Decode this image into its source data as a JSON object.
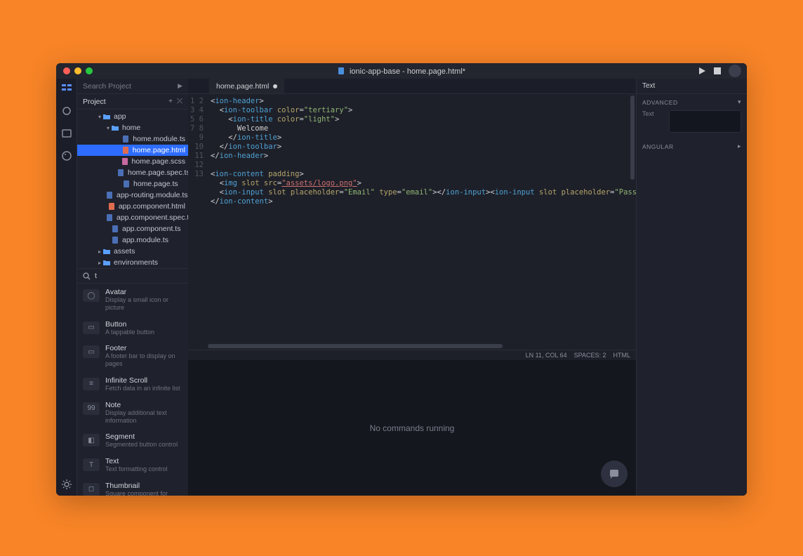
{
  "window": {
    "title_prefix": "ionic-app-base - ",
    "title_file": "home.page.html*"
  },
  "sidebar": {
    "search_placeholder": "Search Project",
    "project_label": "Project",
    "tree": [
      {
        "indent": 28,
        "icon": "folder",
        "label": "app",
        "arrow": "▾"
      },
      {
        "indent": 40,
        "icon": "folder",
        "label": "home",
        "arrow": "▾"
      },
      {
        "indent": 56,
        "icon": "ts",
        "label": "home.module.ts"
      },
      {
        "indent": 56,
        "icon": "html",
        "label": "home.page.html",
        "selected": true
      },
      {
        "indent": 56,
        "icon": "scss",
        "label": "home.page.scss"
      },
      {
        "indent": 56,
        "icon": "ts",
        "label": "home.page.spec.ts"
      },
      {
        "indent": 56,
        "icon": "ts",
        "label": "home.page.ts"
      },
      {
        "indent": 40,
        "icon": "ts",
        "label": "app-routing.module.ts"
      },
      {
        "indent": 40,
        "icon": "html",
        "label": "app.component.html"
      },
      {
        "indent": 40,
        "icon": "ts",
        "label": "app.component.spec.ts"
      },
      {
        "indent": 40,
        "icon": "ts",
        "label": "app.component.ts"
      },
      {
        "indent": 40,
        "icon": "ts",
        "label": "app.module.ts"
      },
      {
        "indent": 28,
        "icon": "folder",
        "label": "assets",
        "arrow": "▸"
      },
      {
        "indent": 28,
        "icon": "folder",
        "label": "environments",
        "arrow": "▸"
      }
    ],
    "filter_value": "t",
    "components": [
      {
        "name": "Avatar",
        "desc": "Display a small icon or picture",
        "glyph": "◯"
      },
      {
        "name": "Button",
        "desc": "A tappable button",
        "glyph": "▭"
      },
      {
        "name": "Footer",
        "desc": "A footer bar to display on pages",
        "glyph": "▭"
      },
      {
        "name": "Infinite Scroll",
        "desc": "Fetch data in an infinite list",
        "glyph": "≡"
      },
      {
        "name": "Note",
        "desc": "Display additional text information",
        "glyph": "99"
      },
      {
        "name": "Segment",
        "desc": "Segmented button control",
        "glyph": "◧"
      },
      {
        "name": "Text",
        "desc": "Text formatting control",
        "glyph": "T"
      },
      {
        "name": "Thumbnail",
        "desc": "Square component for displaying icons",
        "glyph": "◻"
      }
    ]
  },
  "editor": {
    "tab_label": "home.page.html",
    "lines": [
      "<ion-header>",
      "  <ion-toolbar color=\"tertiary\">",
      "    <ion-title color=\"light\">",
      "      Welcome",
      "    </ion-title>",
      "  </ion-toolbar>",
      "</ion-header>",
      "",
      "<ion-content padding>",
      "  <img slot src=\"assets/logo.png\">",
      "  <ion-input slot placeholder=\"Email\" type=\"email\"></ion-input><ion-input slot placeholder=\"Password\" type=\"password\"></ion-input>",
      "</ion-content>",
      ""
    ],
    "status": {
      "pos": "LN 11, COL 64",
      "spaces": "SPACES: 2",
      "lang": "HTML"
    }
  },
  "terminal": {
    "message": "No commands running"
  },
  "right_panel": {
    "title": "Text",
    "advanced_label": "ADVANCED",
    "text_field_label": "Text",
    "text_value": "",
    "angular_label": "ANGULAR"
  }
}
